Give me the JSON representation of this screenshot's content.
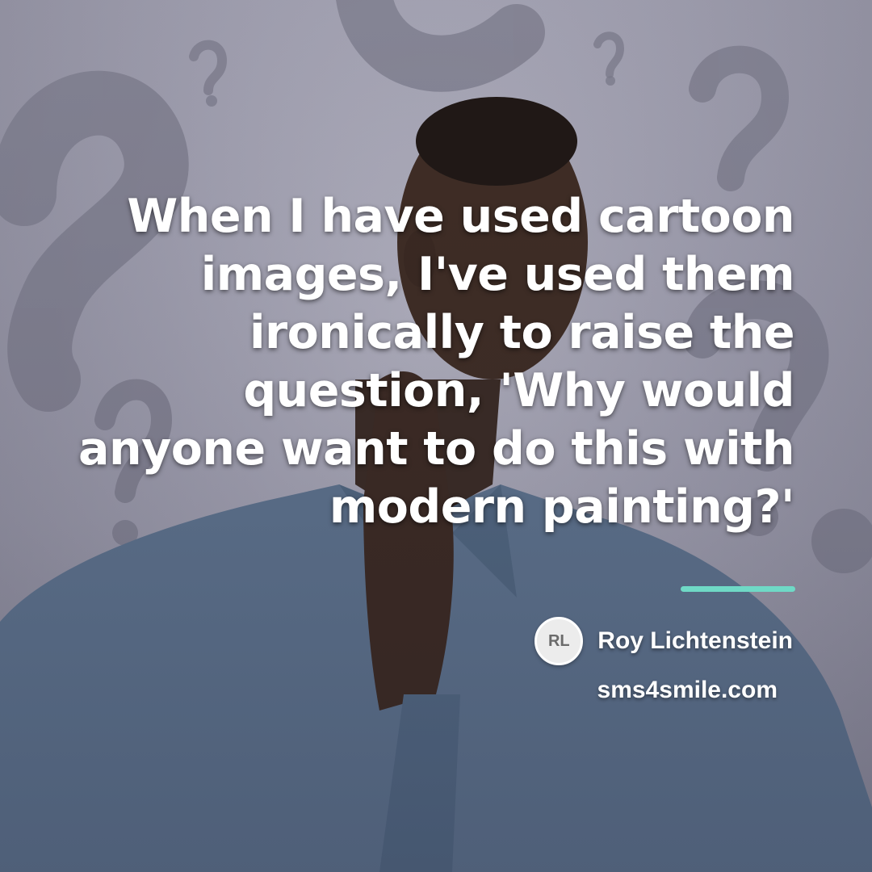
{
  "quote": {
    "lines": [
      "When I have used cartoon",
      "images, I've used them",
      "ironically to raise the",
      "question, 'Why would",
      "anyone want to do this with",
      "modern painting?'"
    ]
  },
  "author": {
    "initials": "RL",
    "name": "Roy Lichtenstein"
  },
  "site": "sms4smile.com",
  "colors": {
    "accent": "#6fd9c6",
    "text": "#ffffff",
    "background": "#a4a3b3"
  }
}
